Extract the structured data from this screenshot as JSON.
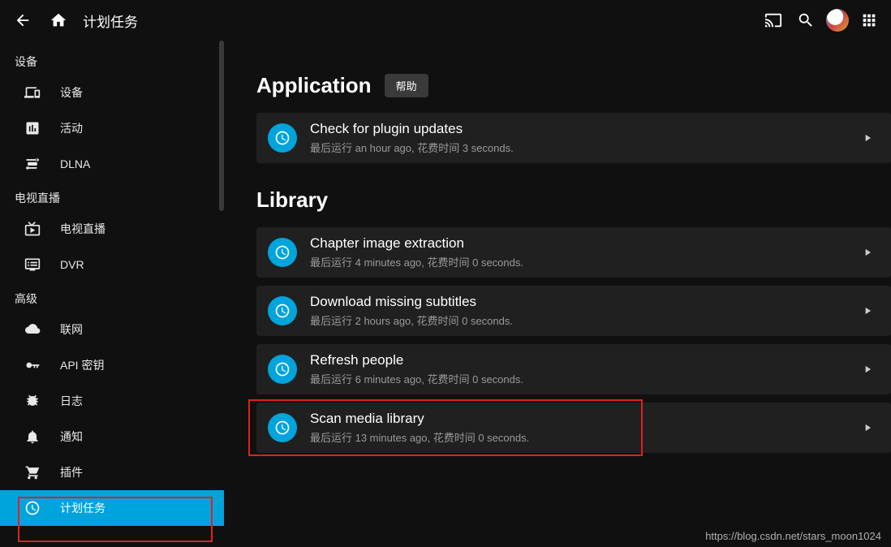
{
  "header": {
    "title": "计划任务"
  },
  "sidebar": {
    "groups": [
      {
        "title": "设备",
        "items": [
          {
            "icon": "devices",
            "label": "设备"
          },
          {
            "icon": "activity",
            "label": "活动"
          },
          {
            "icon": "dlna",
            "label": "DLNA"
          }
        ]
      },
      {
        "title": "电视直播",
        "items": [
          {
            "icon": "livetv",
            "label": "电视直播"
          },
          {
            "icon": "dvr",
            "label": "DVR"
          }
        ]
      },
      {
        "title": "高级",
        "items": [
          {
            "icon": "cloud",
            "label": "联网"
          },
          {
            "icon": "key",
            "label": "API 密钥"
          },
          {
            "icon": "bug",
            "label": "日志"
          },
          {
            "icon": "bell",
            "label": "通知"
          },
          {
            "icon": "cart",
            "label": "插件"
          },
          {
            "icon": "schedule",
            "label": "计划任务",
            "active": true
          }
        ]
      }
    ]
  },
  "content": {
    "sections": [
      {
        "heading": "Application",
        "help_label": "帮助",
        "tasks": [
          {
            "title": "Check for plugin updates",
            "sub": "最后运行 an hour ago, 花费时间 3 seconds."
          }
        ]
      },
      {
        "heading": "Library",
        "tasks": [
          {
            "title": "Chapter image extraction",
            "sub": "最后运行 4 minutes ago, 花费时间 0 seconds."
          },
          {
            "title": "Download missing subtitles",
            "sub": "最后运行 2 hours ago, 花费时间 0 seconds."
          },
          {
            "title": "Refresh people",
            "sub": "最后运行 6 minutes ago, 花费时间 0 seconds."
          },
          {
            "title": "Scan media library",
            "sub": "最后运行 13 minutes ago, 花费时间 0 seconds.",
            "highlighted": true
          }
        ]
      }
    ]
  },
  "watermark": "https://blog.csdn.net/stars_moon1024"
}
